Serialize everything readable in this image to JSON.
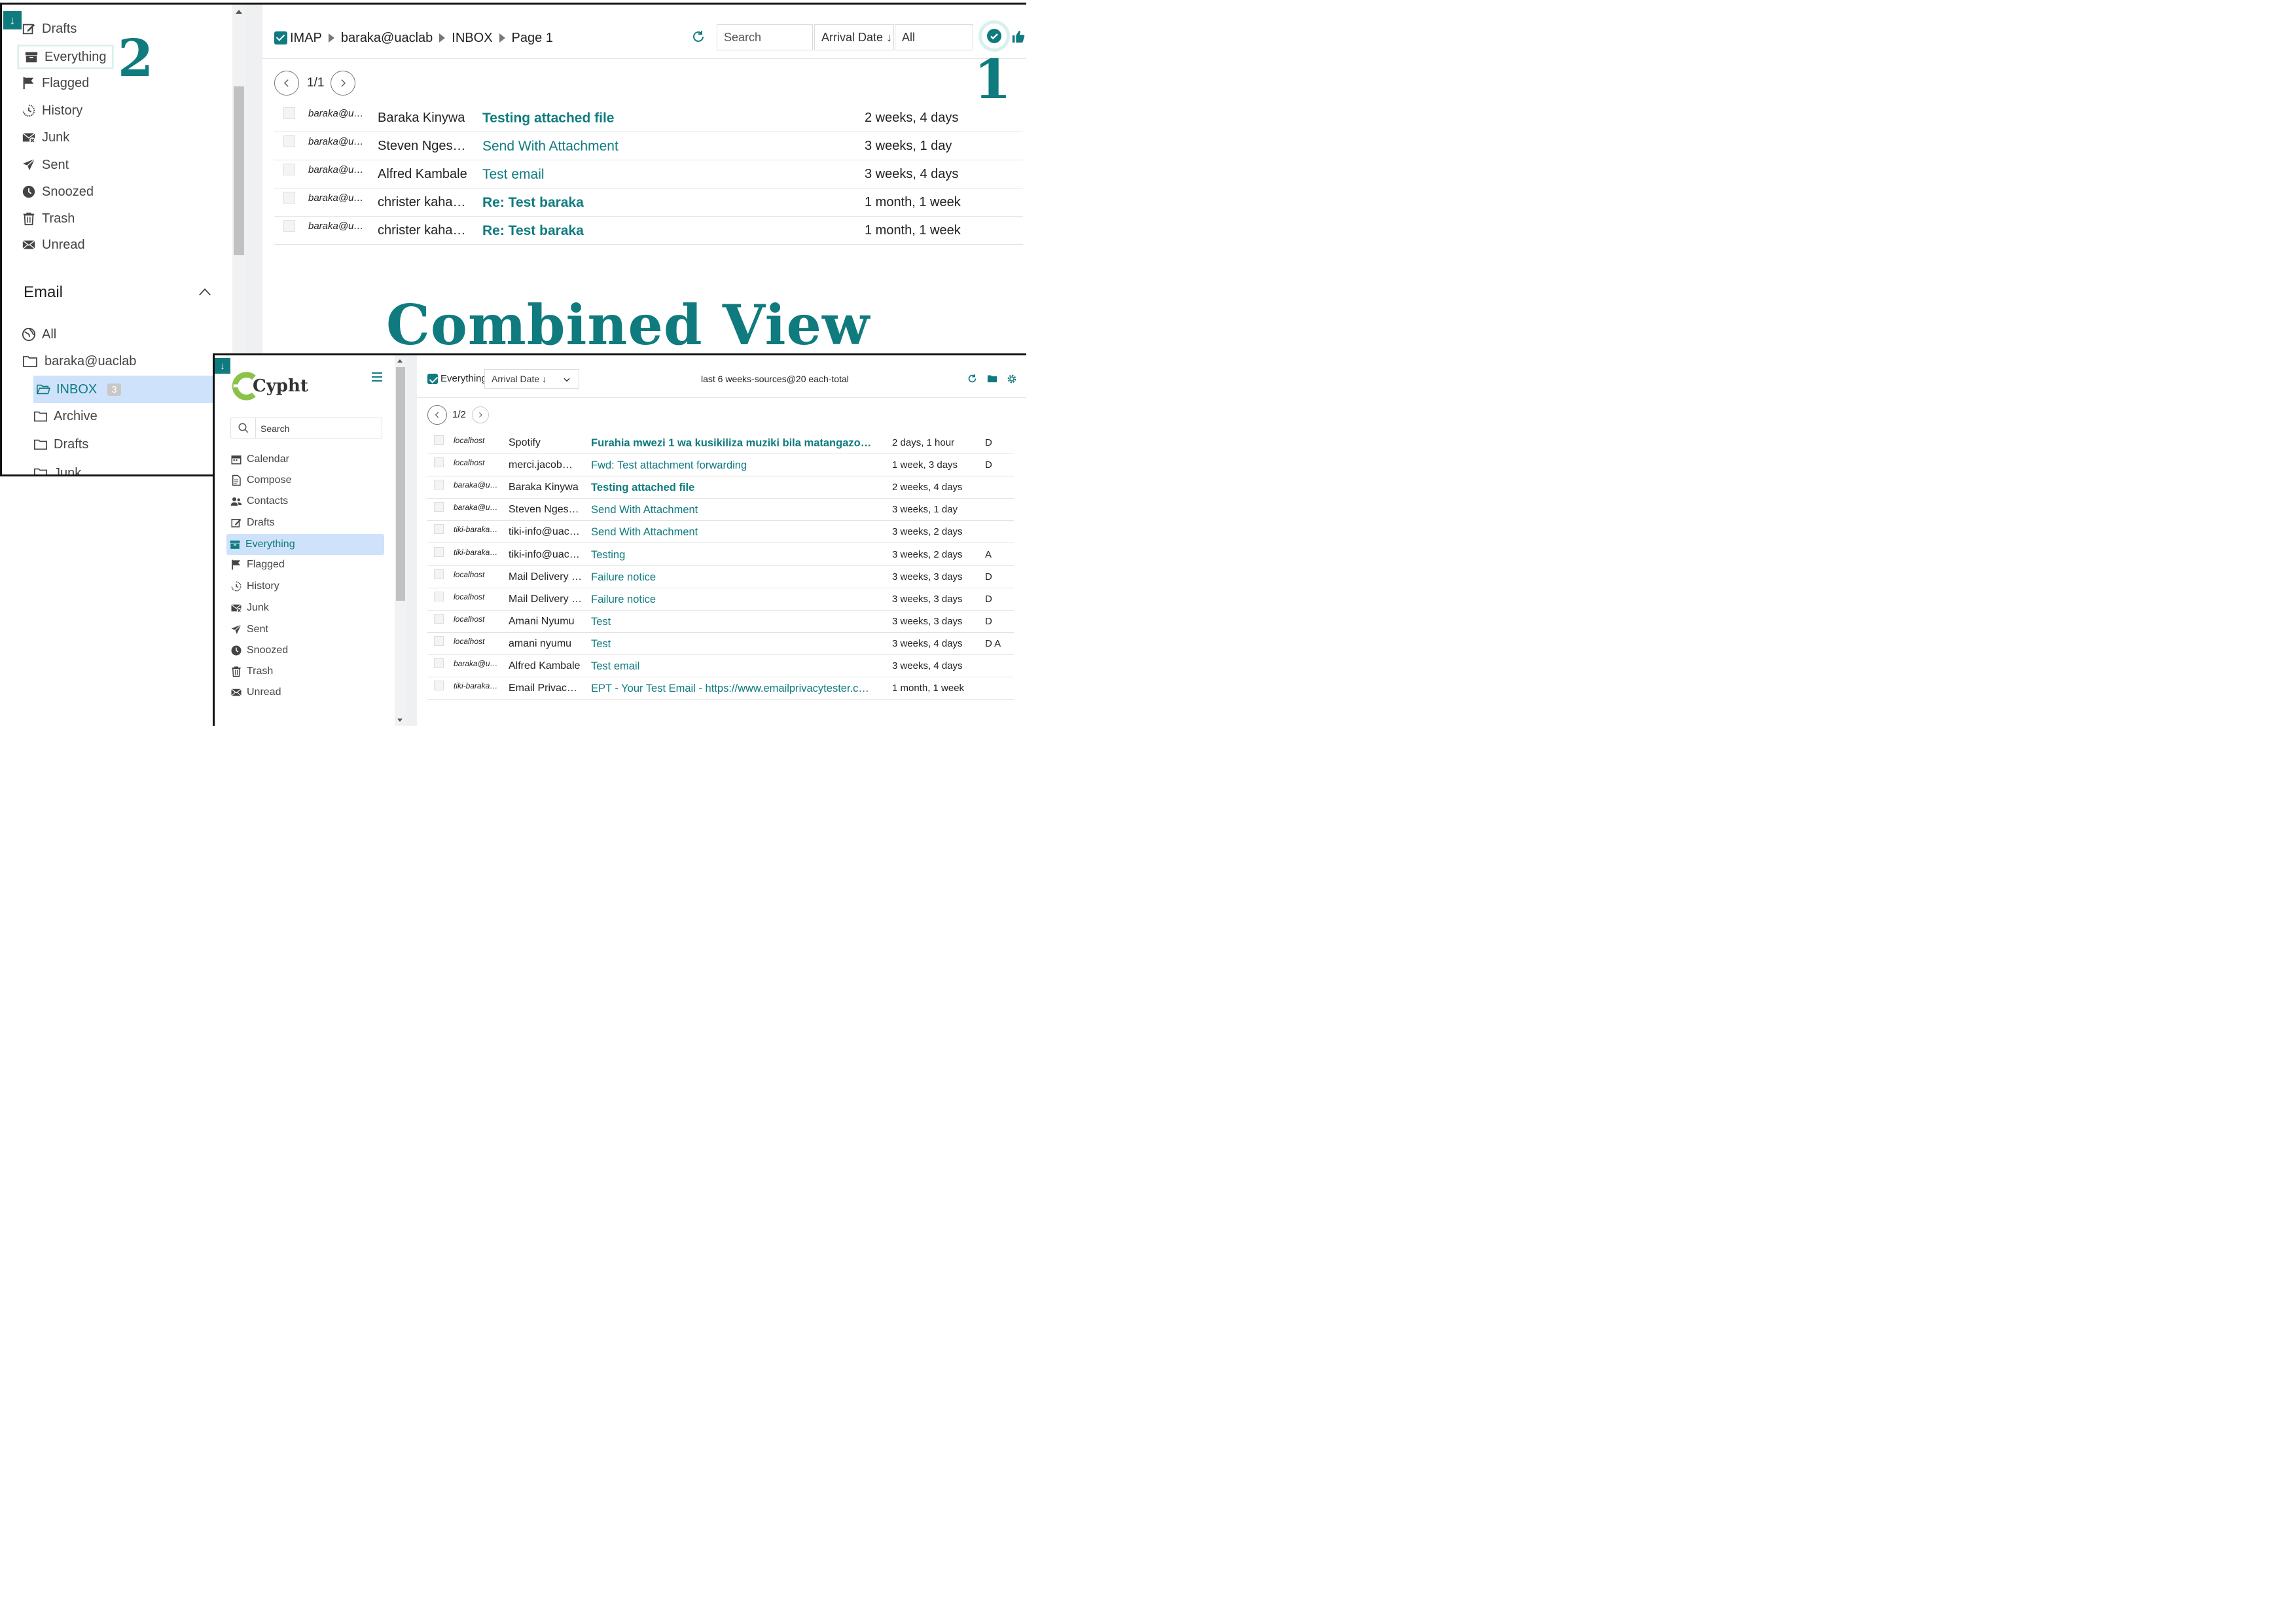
{
  "annotations": {
    "marker_1": "1",
    "marker_2": "2",
    "title": "Combined View"
  },
  "colors": {
    "accent": "#0f7b7f",
    "selected_bg": "#cfe2fc",
    "badge_gray": "#c8c8c8"
  },
  "top": {
    "sidebar": {
      "items": [
        {
          "label": "Drafts",
          "icon": "pencil-square-icon"
        },
        {
          "label": "Everything",
          "icon": "box-icon"
        },
        {
          "label": "Flagged",
          "icon": "flag-icon"
        },
        {
          "label": "History",
          "icon": "clock-history-icon"
        },
        {
          "label": "Junk",
          "icon": "envelope-x-icon"
        },
        {
          "label": "Sent",
          "icon": "send-icon"
        },
        {
          "label": "Snoozed",
          "icon": "clock-fill-icon"
        },
        {
          "label": "Trash",
          "icon": "trash-icon"
        },
        {
          "label": "Unread",
          "icon": "envelope-fill-icon"
        }
      ],
      "email_section": "Email",
      "email_all": "All",
      "account": "baraka@uaclab",
      "folders": [
        {
          "label": "INBOX",
          "badge": "3"
        },
        {
          "label": "Archive"
        },
        {
          "label": "Drafts"
        },
        {
          "label": "Junk"
        }
      ]
    },
    "breadcrumb": [
      "IMAP",
      "baraka@uaclab",
      "INBOX",
      "Page 1"
    ],
    "search_placeholder": "Search",
    "sort": "Arrival Date ↓",
    "filter": "All",
    "pagination": "1/1",
    "messages": [
      {
        "account": "baraka@u…",
        "from": "Baraka Kinywa",
        "subject": "Testing attached file",
        "date": "2 weeks, 4 days",
        "unread": true
      },
      {
        "account": "baraka@u…",
        "from": "Steven Nges…",
        "subject": "Send With Attachment",
        "date": "3 weeks, 1 day",
        "unread": false
      },
      {
        "account": "baraka@u…",
        "from": "Alfred Kambale",
        "subject": "Test email",
        "date": "3 weeks, 4 days",
        "unread": false
      },
      {
        "account": "baraka@u…",
        "from": "christer kaha…",
        "subject": "Re: Test baraka",
        "date": "1 month, 1 week",
        "unread": true
      },
      {
        "account": "baraka@u…",
        "from": "christer kaha…",
        "subject": "Re: Test baraka",
        "date": "1 month, 1 week",
        "unread": true
      }
    ]
  },
  "bottom": {
    "logo": "Cypht",
    "search_placeholder": "Search",
    "sidebar_items": [
      {
        "label": "Calendar",
        "icon": "calendar-icon"
      },
      {
        "label": "Compose",
        "icon": "file-text-icon"
      },
      {
        "label": "Contacts",
        "icon": "people-icon"
      },
      {
        "label": "Drafts",
        "icon": "pencil-square-icon"
      },
      {
        "label": "Everything",
        "icon": "box-icon",
        "active": true
      },
      {
        "label": "Flagged",
        "icon": "flag-icon"
      },
      {
        "label": "History",
        "icon": "clock-history-icon"
      },
      {
        "label": "Junk",
        "icon": "envelope-x-icon"
      },
      {
        "label": "Sent",
        "icon": "send-icon"
      },
      {
        "label": "Snoozed",
        "icon": "clock-fill-icon"
      },
      {
        "label": "Trash",
        "icon": "trash-icon"
      },
      {
        "label": "Unread",
        "icon": "envelope-fill-icon"
      }
    ],
    "header_title": "Everything",
    "sort": "Arrival Date ↓",
    "summary": "last 6 weeks-sources@20 each-total",
    "pagination": "1/2",
    "messages": [
      {
        "account": "localhost",
        "from": "Spotify",
        "subject": "Furahia mwezi 1 wa kusikiliza muziki bila matangazo…",
        "date": "2 days, 1 hour",
        "flags": "D",
        "unread": true
      },
      {
        "account": "localhost",
        "from": "merci.jacob@…",
        "subject": "Fwd: Test attachment forwarding",
        "date": "1 week, 3 days",
        "flags": "D",
        "unread": false
      },
      {
        "account": "baraka@u…",
        "from": "Baraka Kinywa",
        "subject": "Testing attached file",
        "date": "2 weeks, 4 days",
        "flags": "",
        "unread": true
      },
      {
        "account": "baraka@u…",
        "from": "Steven Nges…",
        "subject": "Send With Attachment",
        "date": "3 weeks, 1 day",
        "flags": "",
        "unread": false
      },
      {
        "account": "tiki-baraka…",
        "from": "tiki-info@uacl…",
        "subject": "Send With Attachment",
        "date": "3 weeks, 2 days",
        "flags": "",
        "unread": false
      },
      {
        "account": "tiki-baraka…",
        "from": "tiki-info@uacl…",
        "subject": "Testing",
        "date": "3 weeks, 2 days",
        "flags": "A",
        "unread": false
      },
      {
        "account": "localhost",
        "from": "Mail Delivery …",
        "subject": "Failure notice",
        "date": "3 weeks, 3 days",
        "flags": "D",
        "unread": false
      },
      {
        "account": "localhost",
        "from": "Mail Delivery …",
        "subject": "Failure notice",
        "date": "3 weeks, 3 days",
        "flags": "D",
        "unread": false
      },
      {
        "account": "localhost",
        "from": "Amani Nyumu",
        "subject": "Test",
        "date": "3 weeks, 3 days",
        "flags": "D",
        "unread": false
      },
      {
        "account": "localhost",
        "from": "amani nyumu",
        "subject": "Test",
        "date": "3 weeks, 4 days",
        "flags": "D A",
        "unread": false
      },
      {
        "account": "baraka@u…",
        "from": "Alfred Kambale",
        "subject": "Test email",
        "date": "3 weeks, 4 days",
        "flags": "",
        "unread": false
      },
      {
        "account": "tiki-baraka…",
        "from": "Email Privacy…",
        "subject": "EPT - Your Test Email - https://www.emailprivacytester.c…",
        "date": "1 month, 1 week",
        "flags": "",
        "unread": false
      }
    ]
  }
}
